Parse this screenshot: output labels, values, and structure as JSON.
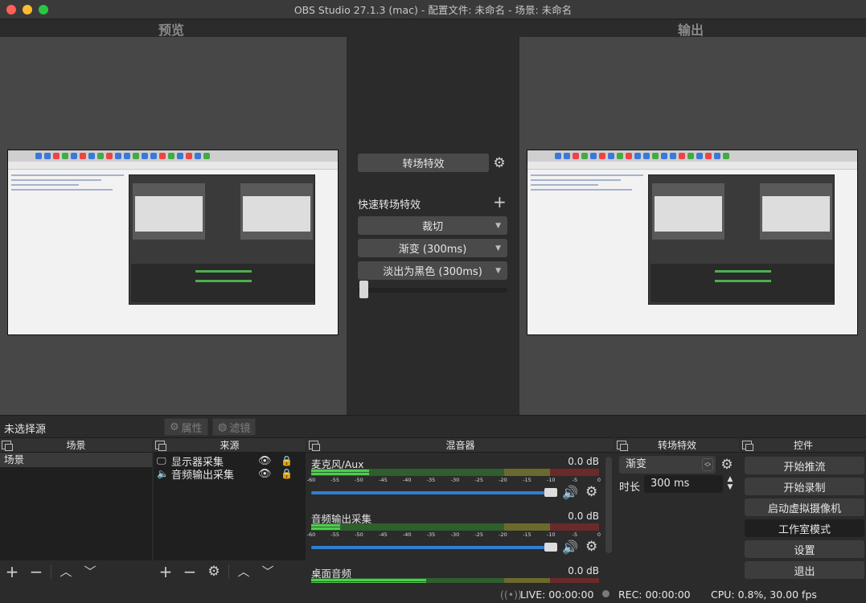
{
  "window": {
    "title": "OBS Studio 27.1.3 (mac) - 配置文件: 未命名 - 场景: 未命名"
  },
  "preview": {
    "left_label": "预览",
    "right_label": "输出"
  },
  "transition_panel": {
    "transition_button": "转场特效",
    "quick_label": "快速转场特效",
    "options": [
      "裁切",
      "渐变 (300ms)",
      "淡出为黑色 (300ms)"
    ]
  },
  "source_bar": {
    "no_source": "未选择源",
    "properties": "属性",
    "filters": "滤镜"
  },
  "scenes": {
    "title": "场景",
    "items": [
      "场景"
    ]
  },
  "sources": {
    "title": "来源",
    "items": [
      "显示器采集",
      "音频输出采集"
    ]
  },
  "mixer": {
    "title": "混音器",
    "ticks": [
      "-60",
      "-55",
      "-50",
      "-45",
      "-40",
      "-35",
      "-30",
      "-25",
      "-20",
      "-15",
      "-10",
      "-5",
      "0"
    ],
    "channels": [
      {
        "name": "麦克风/Aux",
        "db": "0.0 dB",
        "level": 0.2
      },
      {
        "name": "音频输出采集",
        "db": "0.0 dB",
        "level": 0.1
      },
      {
        "name": "桌面音频",
        "db": "0.0 dB",
        "level": 0.4
      }
    ]
  },
  "transitions_dock": {
    "title": "转场特效",
    "selected": "渐变",
    "duration_label": "时长",
    "duration_value": "300 ms"
  },
  "controls": {
    "title": "控件",
    "buttons": [
      "开始推流",
      "开始录制",
      "启动虚拟摄像机",
      "工作室模式",
      "设置",
      "退出"
    ]
  },
  "status": {
    "live": "LIVE: 00:00:00",
    "rec": "REC: 00:00:00",
    "cpu": "CPU: 0.8%, 30.00 fps"
  },
  "colors": {
    "background": "#2b2b2b",
    "meter_green": "#4dce4d",
    "volume_blue": "#2f7fd1"
  }
}
